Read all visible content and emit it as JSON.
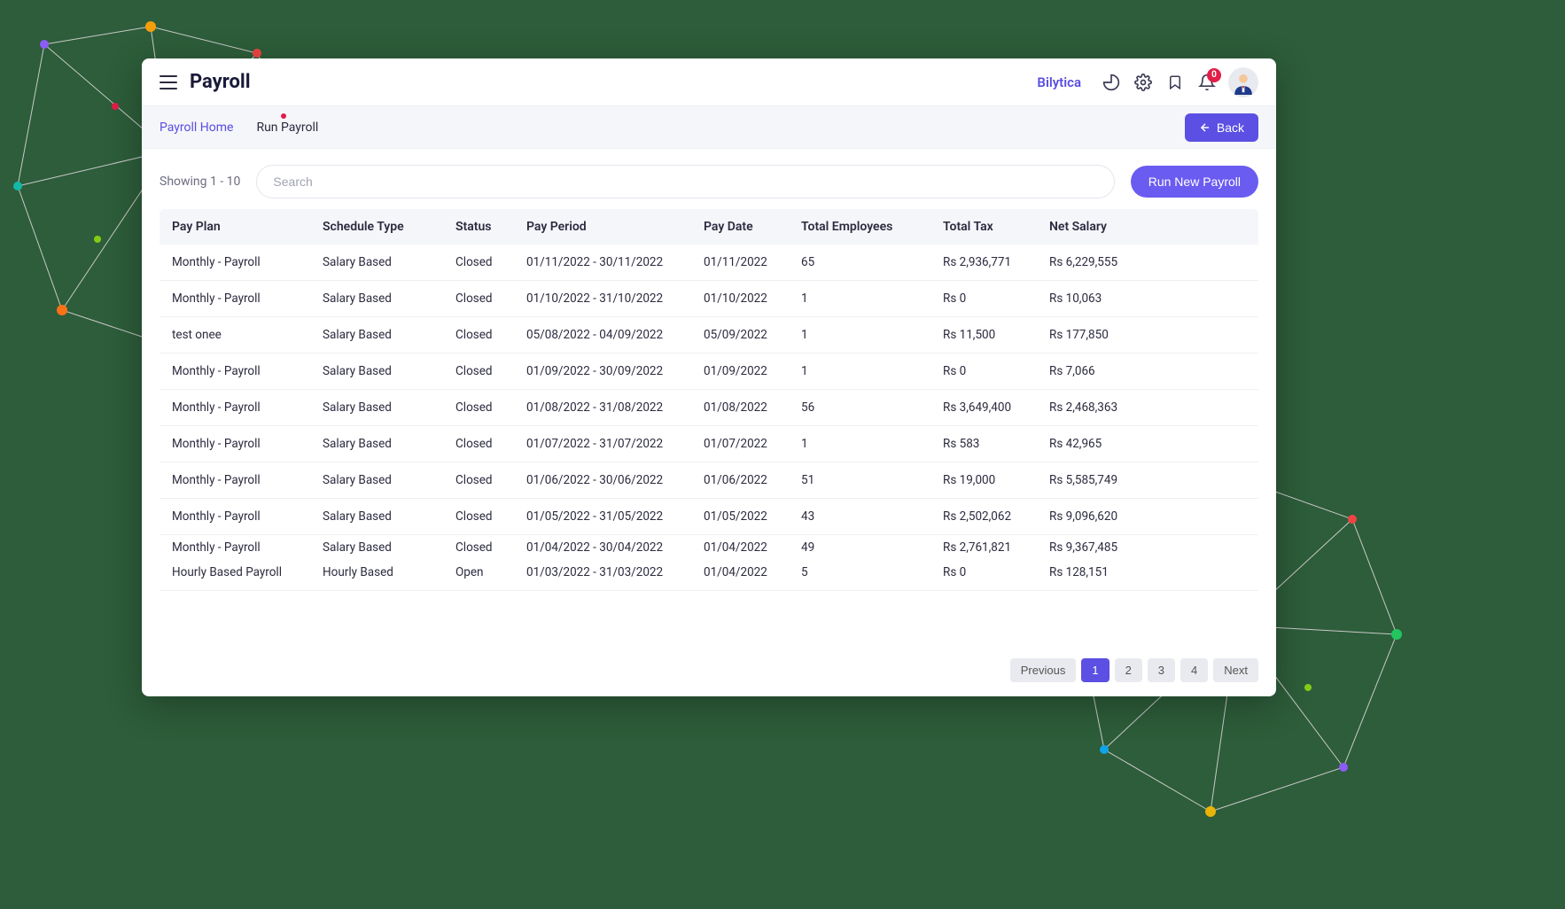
{
  "header": {
    "title": "Payroll",
    "brand": "Bilytica",
    "notif_count": "0"
  },
  "breadcrumb": {
    "home": "Payroll Home",
    "current": "Run Payroll"
  },
  "actions": {
    "back": "Back",
    "run_new": "Run New Payroll"
  },
  "toolbar": {
    "showing": "Showing 1 - 10",
    "search_placeholder": "Search"
  },
  "table": {
    "headers": {
      "pay_plan": "Pay Plan",
      "schedule_type": "Schedule Type",
      "status": "Status",
      "pay_period": "Pay Period",
      "pay_date": "Pay Date",
      "total_employees": "Total Employees",
      "total_tax": "Total Tax",
      "net_salary": "Net Salary"
    },
    "rows": [
      {
        "pay_plan": "Monthly - Payroll",
        "schedule_type": "Salary Based",
        "status": "Closed",
        "pay_period": "01/11/2022 - 30/11/2022",
        "pay_date": "01/11/2022",
        "total_employees": "65",
        "total_tax": "Rs 2,936,771",
        "net_salary": "Rs 6,229,555"
      },
      {
        "pay_plan": "Monthly - Payroll",
        "schedule_type": "Salary Based",
        "status": "Closed",
        "pay_period": "01/10/2022 - 31/10/2022",
        "pay_date": "01/10/2022",
        "total_employees": "1",
        "total_tax": "Rs 0",
        "net_salary": "Rs 10,063"
      },
      {
        "pay_plan": "test onee",
        "schedule_type": "Salary Based",
        "status": "Closed",
        "pay_period": "05/08/2022 - 04/09/2022",
        "pay_date": "05/09/2022",
        "total_employees": "1",
        "total_tax": "Rs 11,500",
        "net_salary": "Rs 177,850"
      },
      {
        "pay_plan": "Monthly - Payroll",
        "schedule_type": "Salary Based",
        "status": "Closed",
        "pay_period": "01/09/2022 - 30/09/2022",
        "pay_date": "01/09/2022",
        "total_employees": "1",
        "total_tax": "Rs 0",
        "net_salary": "Rs 7,066"
      },
      {
        "pay_plan": "Monthly - Payroll",
        "schedule_type": "Salary Based",
        "status": "Closed",
        "pay_period": "01/08/2022 - 31/08/2022",
        "pay_date": "01/08/2022",
        "total_employees": "56",
        "total_tax": "Rs 3,649,400",
        "net_salary": "Rs 2,468,363"
      },
      {
        "pay_plan": "Monthly - Payroll",
        "schedule_type": "Salary Based",
        "status": "Closed",
        "pay_period": "01/07/2022 - 31/07/2022",
        "pay_date": "01/07/2022",
        "total_employees": "1",
        "total_tax": "Rs 583",
        "net_salary": "Rs 42,965"
      },
      {
        "pay_plan": "Monthly - Payroll",
        "schedule_type": "Salary Based",
        "status": "Closed",
        "pay_period": "01/06/2022 - 30/06/2022",
        "pay_date": "01/06/2022",
        "total_employees": "51",
        "total_tax": "Rs 19,000",
        "net_salary": "Rs 5,585,749"
      },
      {
        "pay_plan": "Monthly - Payroll",
        "schedule_type": "Salary Based",
        "status": "Closed",
        "pay_period": "01/05/2022 - 31/05/2022",
        "pay_date": "01/05/2022",
        "total_employees": "43",
        "total_tax": "Rs 2,502,062",
        "net_salary": "Rs 9,096,620"
      },
      {
        "pay_plan": "Monthly - Payroll",
        "schedule_type": "Salary Based",
        "status": "Closed",
        "pay_period": "01/04/2022 - 30/04/2022",
        "pay_date": "01/04/2022",
        "total_employees": "49",
        "total_tax": "Rs 2,761,821",
        "net_salary": "Rs 9,367,485"
      },
      {
        "pay_plan": "Hourly Based Payroll",
        "schedule_type": "Hourly Based",
        "status": "Open",
        "pay_period": "01/03/2022 - 31/03/2022",
        "pay_date": "01/04/2022",
        "total_employees": "5",
        "total_tax": "Rs 0",
        "net_salary": "Rs 128,151"
      }
    ]
  },
  "pagination": {
    "previous": "Previous",
    "pages": [
      "1",
      "2",
      "3",
      "4"
    ],
    "active": "1",
    "next": "Next"
  }
}
